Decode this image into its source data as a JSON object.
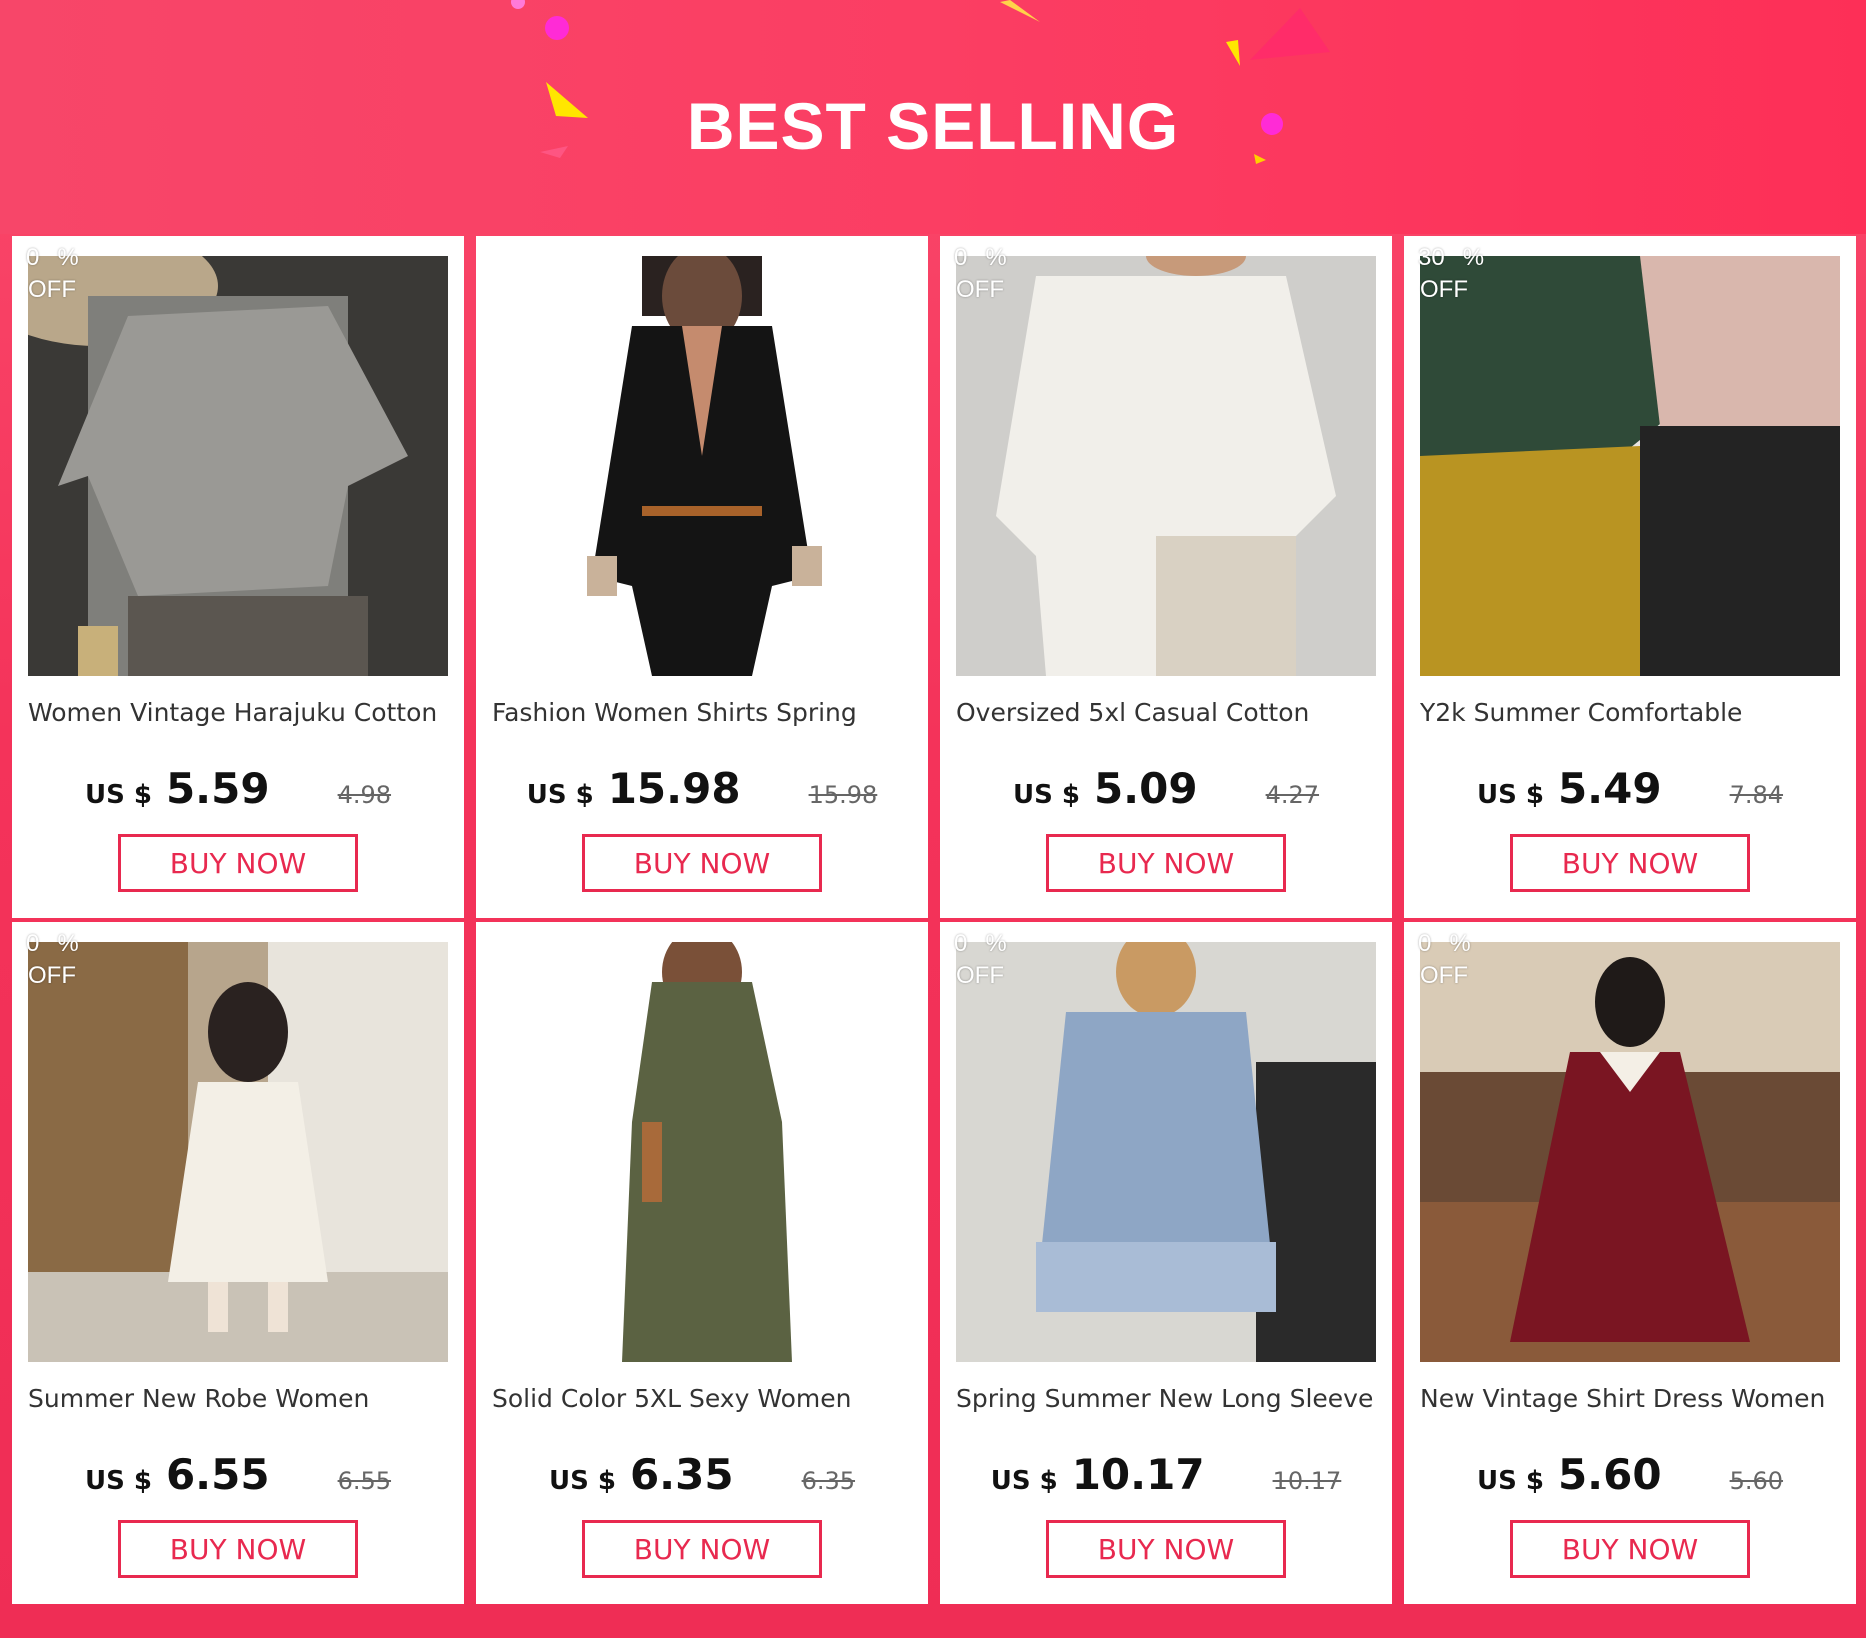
{
  "banner": {
    "title": "BEST SELLING"
  },
  "colors": {
    "accent": "#e8294f",
    "background": "#f4335a",
    "card": "#ffffff"
  },
  "products": [
    {
      "title": "Women Vintage Harajuku Cotton",
      "discount_value": "0",
      "discount_pct": "%",
      "discount_off": "OFF",
      "currency": "US $",
      "price": "5.59",
      "original_price": "4.98",
      "button": "BUY NOW",
      "photo": "gray-linen-top"
    },
    {
      "title": "Fashion Women Shirts Spring",
      "discount_value": "",
      "discount_pct": "",
      "discount_off": "",
      "currency": "US $",
      "price": "15.98",
      "original_price": "15.98",
      "button": "BUY NOW",
      "photo": "black-shirt-jumpsuit"
    },
    {
      "title": "Oversized 5xl Casual Cotton",
      "discount_value": "0",
      "discount_pct": "%",
      "discount_off": "OFF",
      "currency": "US $",
      "price": "5.09",
      "original_price": "4.27",
      "button": "BUY NOW",
      "photo": "white-linen-shirt"
    },
    {
      "title": "Y2k Summer Comfortable",
      "discount_value": "30",
      "discount_pct": "%",
      "discount_off": "OFF",
      "currency": "US $",
      "price": "5.49",
      "original_price": "7.84",
      "button": "BUY NOW",
      "photo": "satin-tees"
    },
    {
      "title": "Summer New Robe Women",
      "discount_value": "0",
      "discount_pct": "%",
      "discount_off": "OFF",
      "currency": "US $",
      "price": "6.55",
      "original_price": "6.55",
      "button": "BUY NOW",
      "photo": "floral-dress"
    },
    {
      "title": "Solid Color  5XL Sexy Women",
      "discount_value": "",
      "discount_pct": "",
      "discount_off": "",
      "currency": "US $",
      "price": "6.35",
      "original_price": "6.35",
      "button": "BUY NOW",
      "photo": "olive-maxi-dress"
    },
    {
      "title": "Spring Summer New Long Sleeve",
      "discount_value": "0",
      "discount_pct": "%",
      "discount_off": "OFF",
      "currency": "US $",
      "price": "10.17",
      "original_price": "10.17",
      "button": "BUY NOW",
      "photo": "blue-lace-dress"
    },
    {
      "title": "New Vintage Shirt Dress Women",
      "discount_value": "0",
      "discount_pct": "%",
      "discount_off": "OFF",
      "currency": "US $",
      "price": "5.60",
      "original_price": "5.60",
      "button": "BUY NOW",
      "photo": "burgundy-dress"
    }
  ]
}
